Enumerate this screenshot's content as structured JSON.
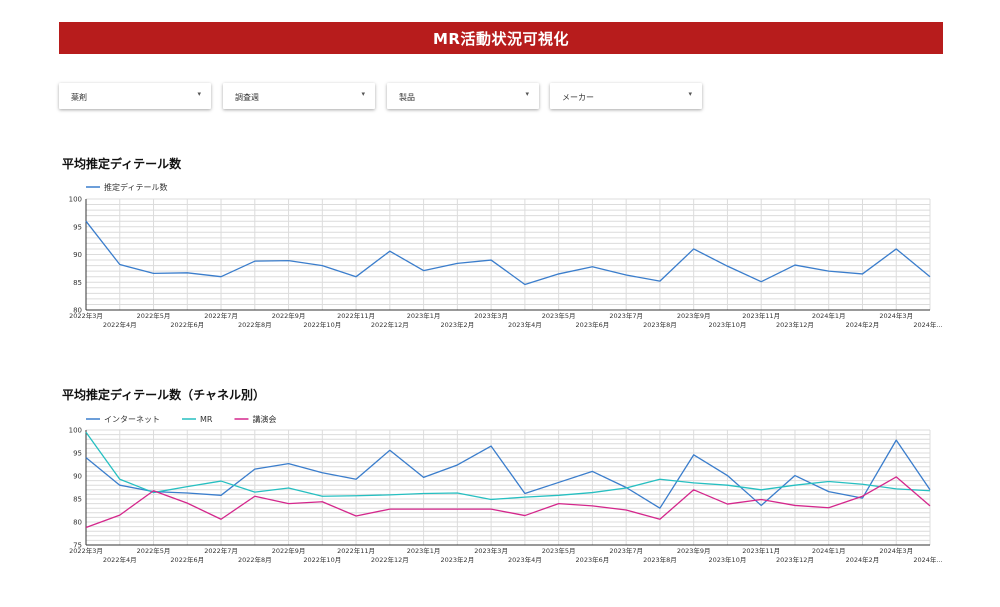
{
  "header": {
    "title": "MR活動状況可視化"
  },
  "filters": [
    {
      "label": "薬剤",
      "caret": "▾"
    },
    {
      "label": "調査週",
      "caret": "▾"
    },
    {
      "label": "製品",
      "caret": "▾"
    },
    {
      "label": "メーカー",
      "caret": "▾"
    }
  ],
  "colors": {
    "header": "#b71c1c",
    "internet": "#3a7dcc",
    "mr": "#26bfc1",
    "lecture": "#d4278c"
  },
  "chart_data": [
    {
      "type": "line",
      "title": "平均推定ディテール数",
      "legend_position": "top-left",
      "grid": true,
      "ylim": [
        80,
        100
      ],
      "yticks": [
        80,
        85,
        90,
        95,
        100
      ],
      "categories": [
        "2022年3月",
        "2022年4月",
        "2022年5月",
        "2022年6月",
        "2022年7月",
        "2022年8月",
        "2022年9月",
        "2022年10月",
        "2022年11月",
        "2022年12月",
        "2023年1月",
        "2023年2月",
        "2023年3月",
        "2023年4月",
        "2023年5月",
        "2023年6月",
        "2023年7月",
        "2023年8月",
        "2023年9月",
        "2023年10月",
        "2023年11月",
        "2023年12月",
        "2024年1月",
        "2024年2月",
        "2024年3月",
        "2024年..."
      ],
      "series": [
        {
          "name": "推定ディテール数",
          "color": "#3a7dcc",
          "values": [
            96.0,
            88.2,
            86.6,
            86.7,
            86.0,
            88.8,
            88.9,
            88.0,
            86.0,
            90.6,
            87.1,
            88.4,
            89.0,
            84.6,
            86.5,
            87.8,
            86.3,
            85.2,
            91.0,
            87.9,
            85.1,
            88.1,
            87.0,
            86.5,
            91.0,
            86.0
          ]
        }
      ]
    },
    {
      "type": "line",
      "title": "平均推定ディテール数（チャネル別）",
      "legend_position": "top-left",
      "grid": true,
      "ylim": [
        75,
        100
      ],
      "yticks": [
        75,
        80,
        85,
        90,
        95,
        100
      ],
      "categories": [
        "2022年3月",
        "2022年4月",
        "2022年5月",
        "2022年6月",
        "2022年7月",
        "2022年8月",
        "2022年9月",
        "2022年10月",
        "2022年11月",
        "2022年12月",
        "2023年1月",
        "2023年2月",
        "2023年3月",
        "2023年4月",
        "2023年5月",
        "2023年6月",
        "2023年7月",
        "2023年8月",
        "2023年9月",
        "2023年10月",
        "2023年11月",
        "2023年12月",
        "2024年1月",
        "2024年2月",
        "2024年3月",
        "2024年..."
      ],
      "series": [
        {
          "name": "インターネット",
          "color": "#3a7dcc",
          "values": [
            94.0,
            88.0,
            86.6,
            86.3,
            85.8,
            91.5,
            92.7,
            90.7,
            89.3,
            95.6,
            89.7,
            92.4,
            96.5,
            86.2,
            88.6,
            91.0,
            87.5,
            83.0,
            94.6,
            90.1,
            83.6,
            90.1,
            86.6,
            85.2,
            97.8,
            87.0
          ]
        },
        {
          "name": "MR",
          "color": "#26bfc1",
          "values": [
            99.5,
            89.3,
            86.4,
            87.7,
            88.9,
            86.5,
            87.4,
            85.6,
            85.7,
            85.9,
            86.2,
            86.3,
            84.9,
            85.4,
            85.8,
            86.4,
            87.4,
            89.3,
            88.5,
            88.0,
            87.0,
            88.0,
            88.8,
            88.2,
            87.2,
            86.8
          ]
        },
        {
          "name": "講演会",
          "color": "#d4278c",
          "values": [
            78.8,
            81.5,
            86.8,
            84.1,
            80.6,
            85.6,
            84.0,
            84.4,
            81.3,
            82.8,
            82.8,
            82.8,
            82.8,
            81.4,
            84.0,
            83.5,
            82.6,
            80.6,
            87.0,
            83.9,
            84.9,
            83.6,
            83.1,
            85.6,
            89.8,
            83.5
          ]
        }
      ]
    }
  ]
}
